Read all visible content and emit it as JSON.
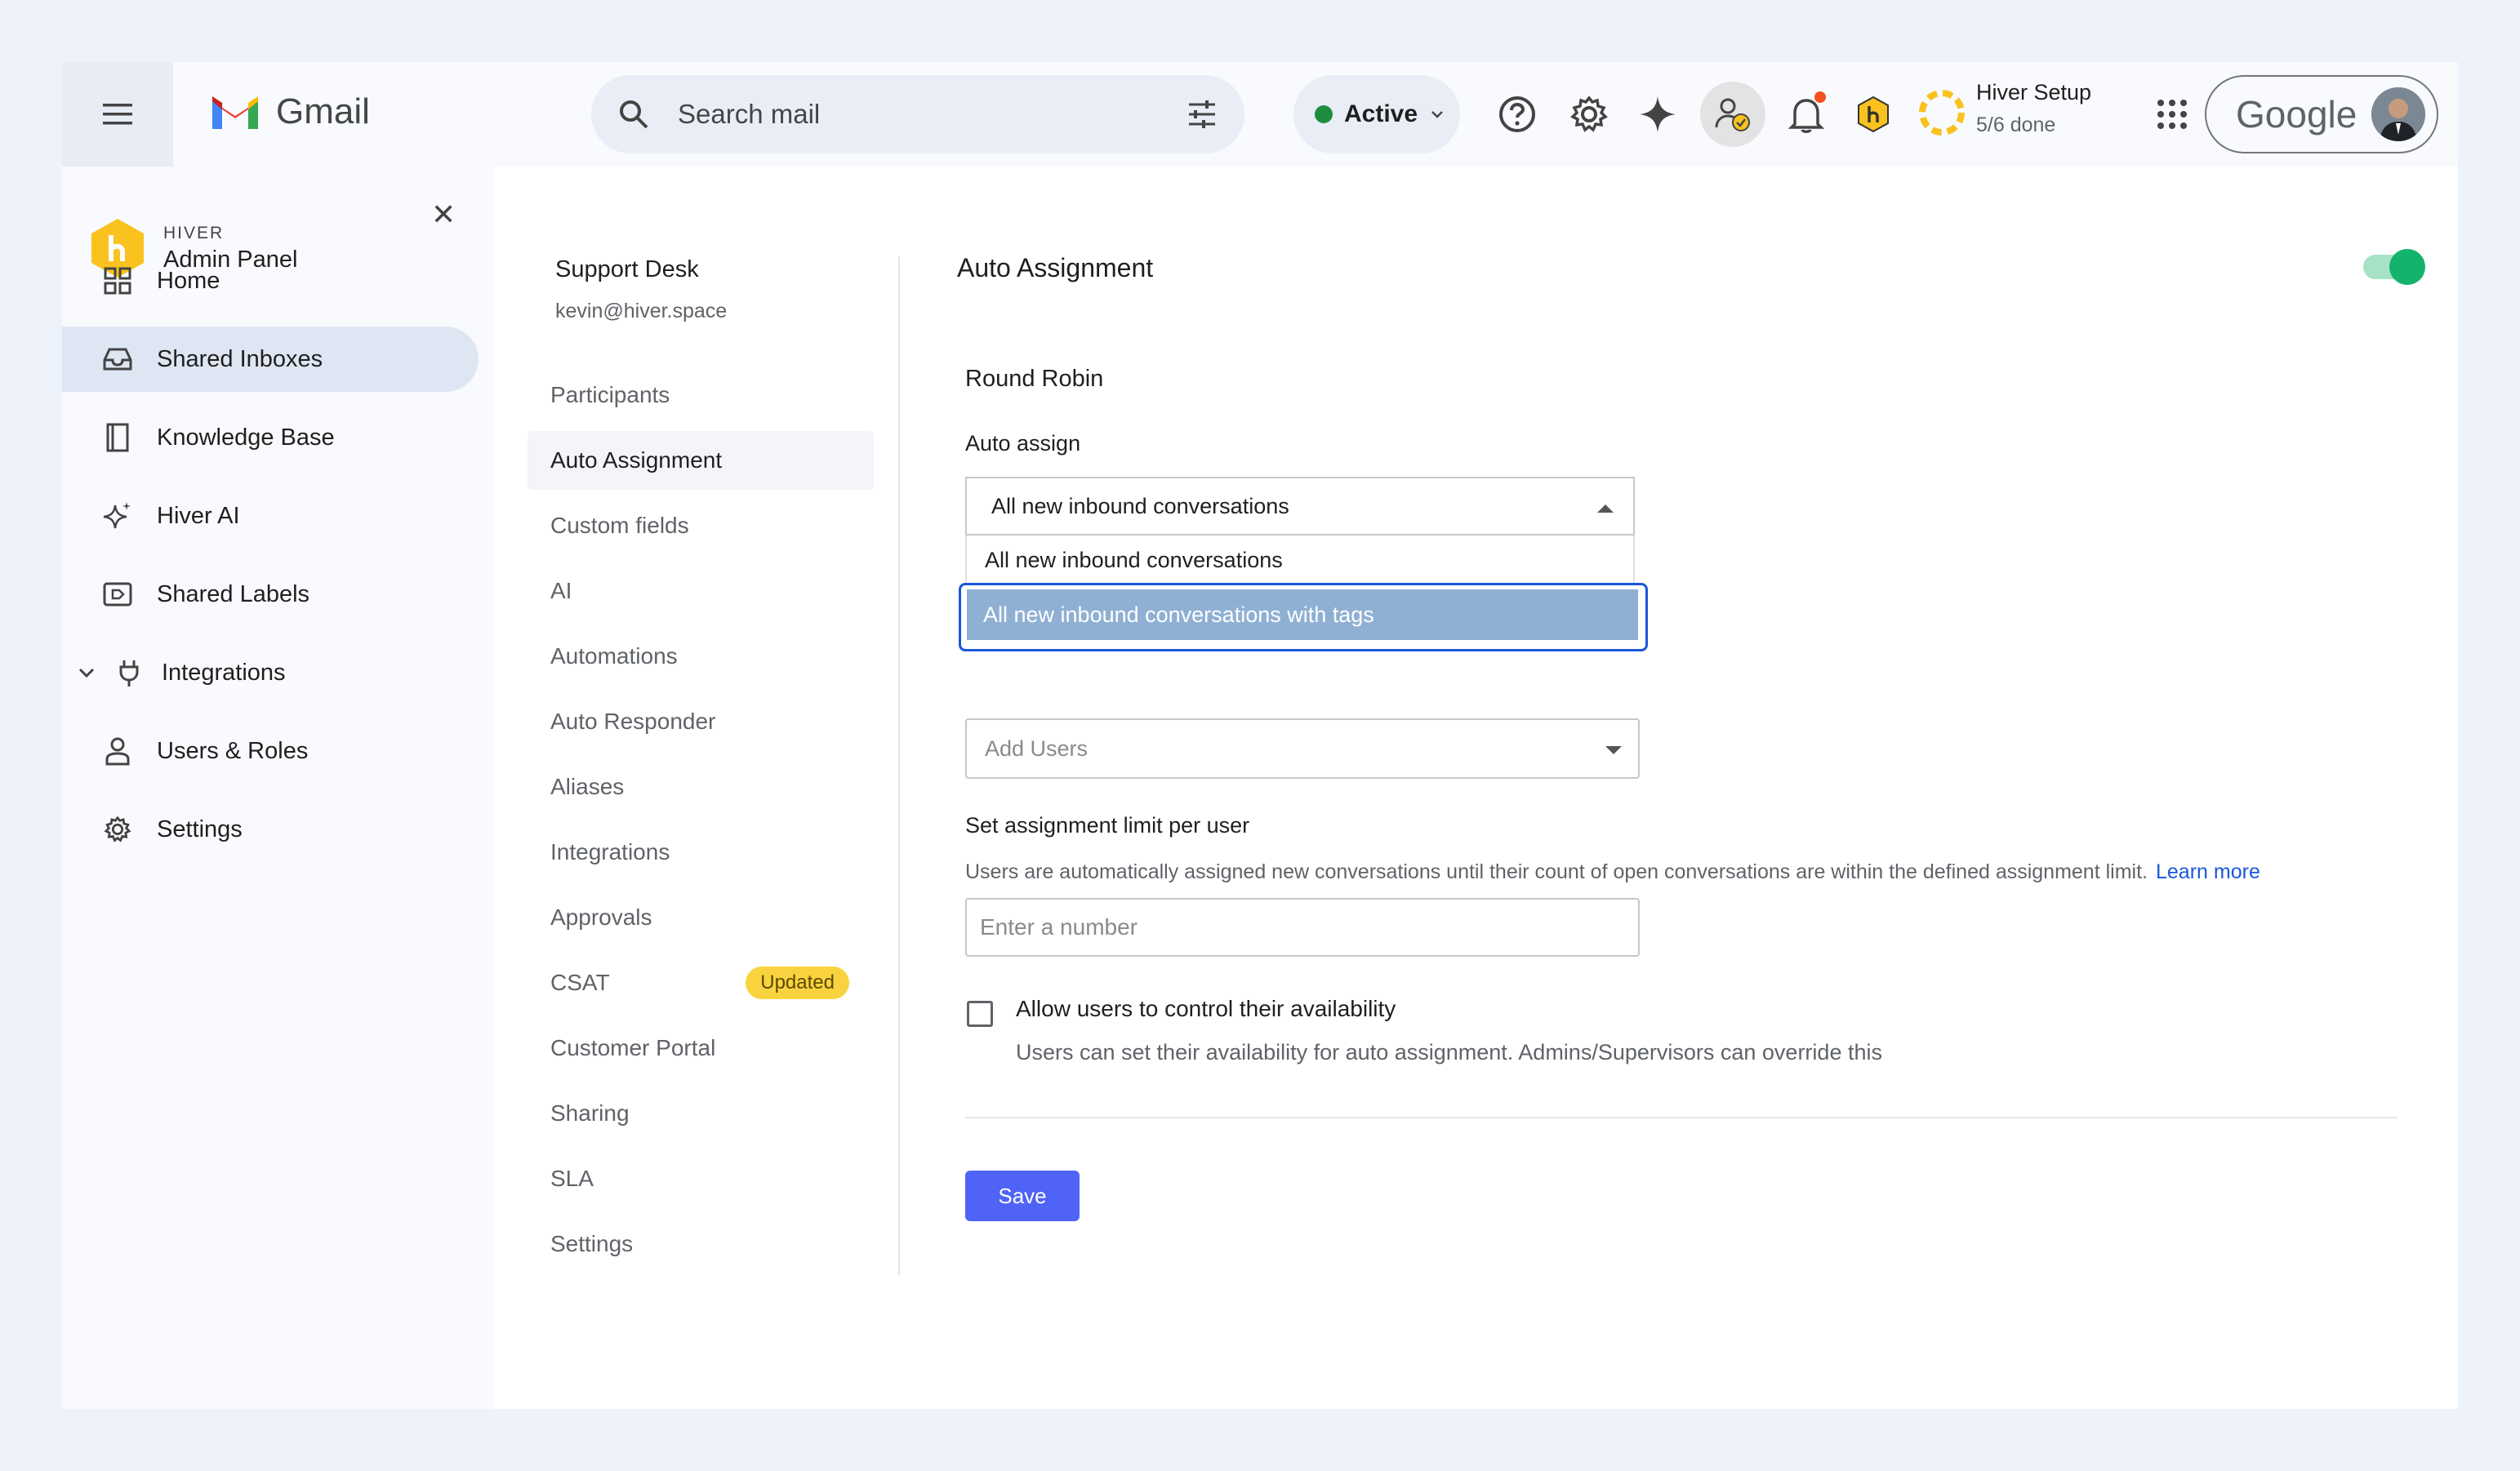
{
  "topbar": {
    "app_name": "Gmail",
    "search_placeholder": "Search mail",
    "status": "Active",
    "setup_title": "Hiver Setup",
    "setup_progress": "5/6 done",
    "account_brand": "Google"
  },
  "sidebar": {
    "brand_small": "HIVER",
    "brand_title": "Admin Panel",
    "items": [
      {
        "label": "Home",
        "icon": "grid-icon"
      },
      {
        "label": "Shared Inboxes",
        "icon": "inbox-icon"
      },
      {
        "label": "Knowledge Base",
        "icon": "book-icon"
      },
      {
        "label": "Hiver AI",
        "icon": "sparkle-icon"
      },
      {
        "label": "Shared Labels",
        "icon": "label-icon"
      },
      {
        "label": "Integrations",
        "icon": "plug-icon"
      },
      {
        "label": "Users & Roles",
        "icon": "user-icon"
      },
      {
        "label": "Settings",
        "icon": "gear-icon"
      }
    ],
    "selected": "Shared Inboxes"
  },
  "inbox": {
    "name": "Support Desk",
    "email": "kevin@hiver.space",
    "menu": [
      {
        "label": "Participants"
      },
      {
        "label": "Auto Assignment"
      },
      {
        "label": "Custom fields"
      },
      {
        "label": "AI"
      },
      {
        "label": "Automations"
      },
      {
        "label": "Auto Responder"
      },
      {
        "label": "Aliases"
      },
      {
        "label": "Integrations"
      },
      {
        "label": "Approvals"
      },
      {
        "label": "CSAT",
        "badge": "Updated"
      },
      {
        "label": "Customer Portal"
      },
      {
        "label": "Sharing"
      },
      {
        "label": "SLA"
      },
      {
        "label": "Settings"
      }
    ],
    "selected": "Auto Assignment"
  },
  "settings": {
    "title": "Auto Assignment",
    "enabled": true,
    "method": "Round Robin",
    "auto_assign_label": "Auto assign",
    "auto_assign_value": "All new inbound conversations",
    "auto_assign_options": [
      "All new inbound conversations",
      "All new inbound conversations with tags"
    ],
    "users_placeholder": "Add Users",
    "limit_label": "Set assignment limit per user",
    "limit_help": "Users are automatically assigned new conversations until their count of open conversations are within the defined assignment limit.",
    "learn_more": "Learn more",
    "limit_placeholder": "Enter a number",
    "availability_label": "Allow users to control their availability",
    "availability_help": "Users can set their availability for auto assignment. Admins/Supervisors can override this",
    "availability_checked": false,
    "save_label": "Save"
  },
  "colors": {
    "accent": "#4f63f7",
    "toggle_on": "#14b36b",
    "selected_option": "#8fb0d3",
    "badge": "#f9d33f"
  }
}
